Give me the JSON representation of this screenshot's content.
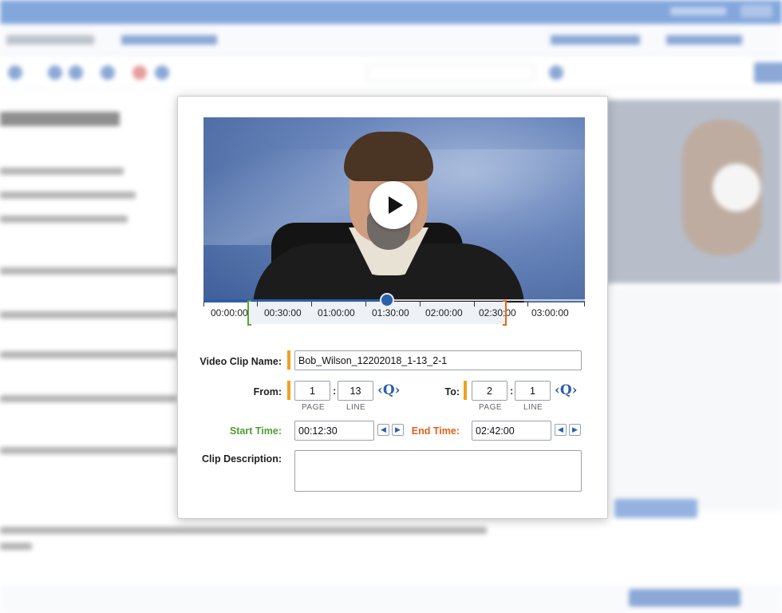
{
  "timeline": {
    "ticks": [
      "00:00:00",
      "00:30:00",
      "01:00:00",
      "01:30:00",
      "02:00:00",
      "02:30:00",
      "03:00:00"
    ]
  },
  "form": {
    "clip_name_label": "Video Clip Name:",
    "clip_name_value": "Bob_Wilson_12202018_1-13_2-1",
    "from_label": "From:",
    "from_page": "1",
    "from_line": "13",
    "to_label": "To:",
    "to_page": "2",
    "to_line": "1",
    "page_sublabel": "PAGE",
    "line_sublabel": "LINE",
    "colon": ":",
    "q_button": "Q",
    "start_label": "Start Time:",
    "start_value": "00:12:30",
    "end_label": "End Time:",
    "end_value": "02:42:00",
    "description_label": "Clip Description:",
    "description_value": ""
  },
  "colors": {
    "accent_blue": "#2b5faa",
    "start_green": "#4e9e32",
    "end_orange": "#e2601a",
    "label_bar": "#f0a01e"
  },
  "icons": {
    "play": "play-icon",
    "prev": "chevron-left-icon",
    "next": "chevron-right-icon",
    "quick": "quick-search-icon"
  }
}
